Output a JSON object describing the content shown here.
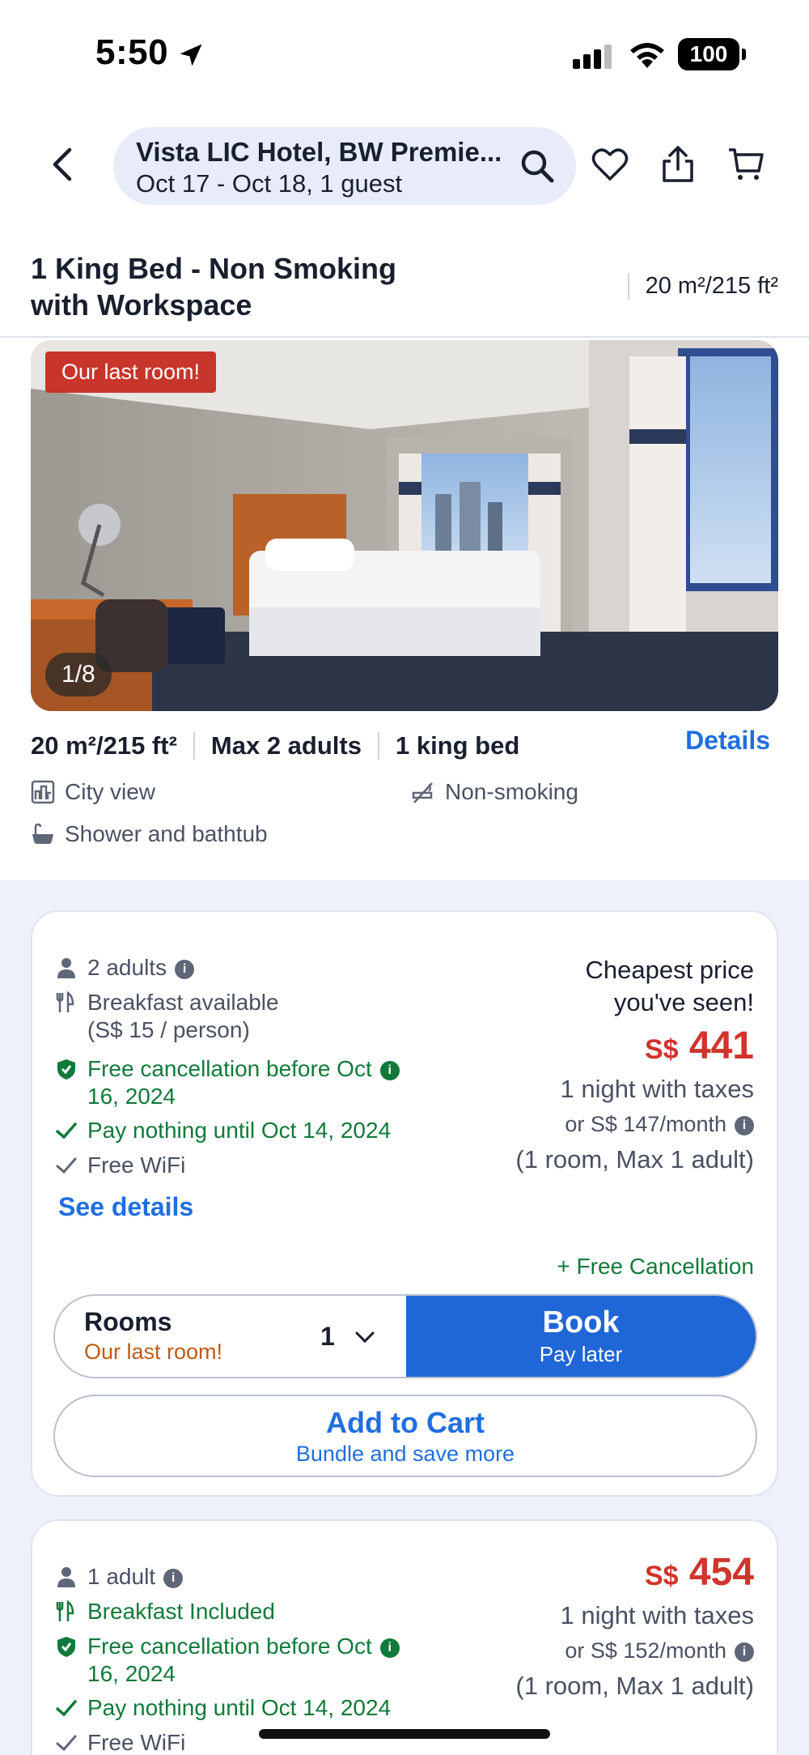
{
  "status_bar": {
    "time": "5:50",
    "battery": "100"
  },
  "search": {
    "title": "Vista LIC Hotel, BW Premie...",
    "subtitle": "Oct 17 - Oct 18, 1 guest"
  },
  "room": {
    "title_line1": "1 King Bed - Non Smoking",
    "title_line2": "with Workspace",
    "size_header": "20 m²/215 ft²",
    "photo_tag": "Our last room!",
    "photo_counter": "1/8",
    "specs": [
      "20 m²/215 ft²",
      "Max 2 adults",
      "1 king bed"
    ],
    "details_label": "Details",
    "amenities": {
      "city_view": "City view",
      "non_smoking": "Non-smoking",
      "bath": "Shower and bathtub"
    }
  },
  "offers": [
    {
      "occupancy": "2 adults",
      "breakfast_line1": "Breakfast available",
      "breakfast_line2": "(S$ 15 / person)",
      "cancel_line1": "Free cancellation before Oct",
      "cancel_line2": "16, 2024",
      "pay": "Pay nothing until Oct 14, 2024",
      "wifi": "Free WiFi",
      "badge_line1": "Cheapest price",
      "badge_line2": "you've seen!",
      "currency": "S$",
      "price": "441",
      "night": "1 night with taxes",
      "monthly": "or S$ 147/month",
      "room_info": "(1 room, Max 1 adult)",
      "see_details": "See details",
      "free_cancel_tag": "+ Free Cancellation",
      "rooms_label": "Rooms",
      "rooms_sub": "Our last room!",
      "rooms_value": "1",
      "book_label": "Book",
      "book_sub": "Pay later",
      "cart_label": "Add to Cart",
      "cart_sub": "Bundle and save more"
    },
    {
      "occupancy": "1 adult",
      "breakfast": "Breakfast Included",
      "cancel_line1": "Free cancellation before Oct",
      "cancel_line2": "16, 2024",
      "pay": "Pay nothing until Oct 14, 2024",
      "wifi": "Free WiFi",
      "currency": "S$",
      "price": "454",
      "night": "1 night with taxes",
      "monthly": "or S$ 152/month",
      "room_info": "(1 room, Max 1 adult)"
    }
  ],
  "colors": {
    "accent": "#1f66d6",
    "price_red": "#d0342c",
    "green": "#117a3a",
    "offers_bg": "#eef1fa"
  }
}
